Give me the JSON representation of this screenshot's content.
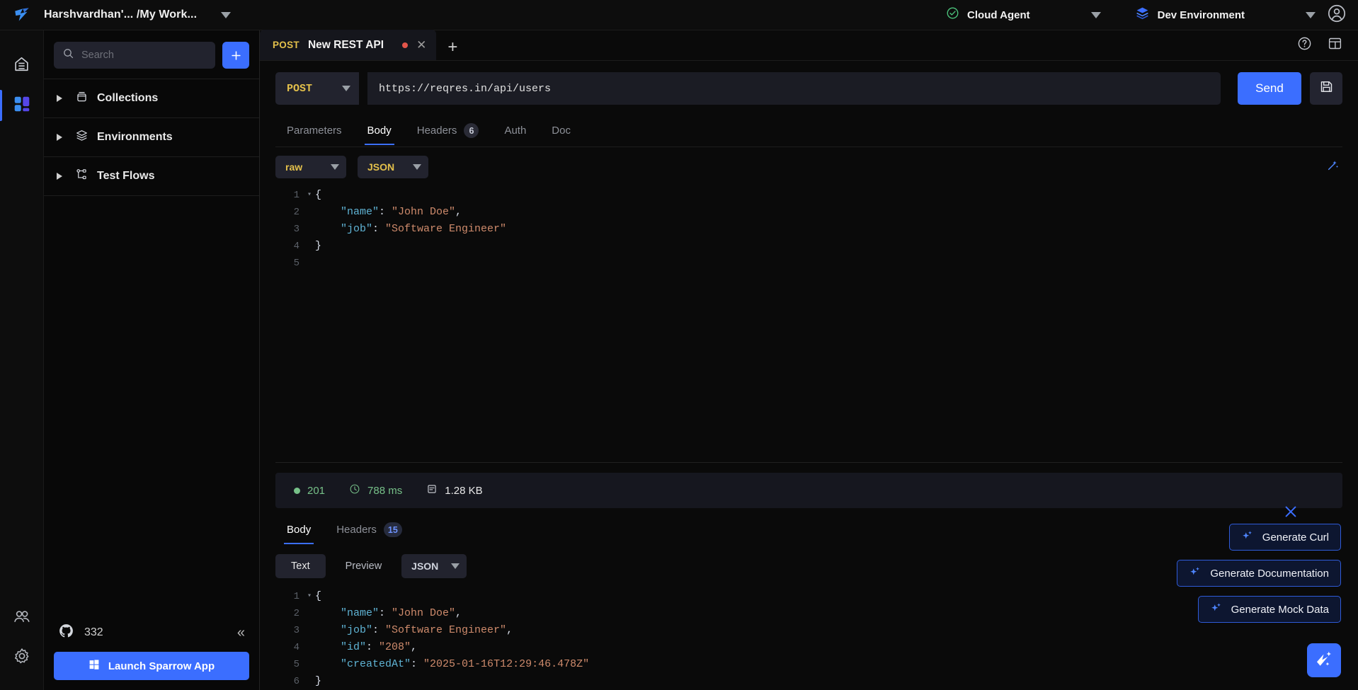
{
  "topbar": {
    "logo_icon": "sparrow-bird-logo",
    "workspace": "Harshvardhan'... /My Work...",
    "workspace_caret_icon": "chevron-down-icon",
    "cloud_agent": {
      "icon": "check-circle-icon",
      "label": "Cloud Agent",
      "caret_icon": "chevron-down-icon"
    },
    "environment": {
      "icon": "layers-icon",
      "label": "Dev Environment",
      "caret_icon": "chevron-down-icon"
    },
    "account_icon": "user-circle-icon"
  },
  "rail": {
    "items": [
      {
        "name": "home",
        "icon": "home-icon",
        "active": false
      },
      {
        "name": "workspaces",
        "icon": "grid-blocks-icon",
        "active": true
      }
    ],
    "bottom_items": [
      {
        "name": "team",
        "icon": "people-icon"
      },
      {
        "name": "settings",
        "icon": "gear-icon"
      }
    ]
  },
  "sidebar": {
    "search": {
      "icon": "search-icon",
      "placeholder": "Search",
      "value": ""
    },
    "add_button": {
      "icon": "plus-icon",
      "label": "+"
    },
    "items": [
      {
        "label": "Collections",
        "icon": "collection-icon",
        "expand_icon": "triangle-right-icon"
      },
      {
        "label": "Environments",
        "icon": "layers-icon",
        "expand_icon": "triangle-right-icon"
      },
      {
        "label": "Test Flows",
        "icon": "flow-nodes-icon",
        "expand_icon": "triangle-right-icon"
      }
    ],
    "github": {
      "icon": "github-icon",
      "count": "332"
    },
    "collapse_icon": "chevron-double-left-icon",
    "launch_button": {
      "icon": "windows-icon",
      "label": "Launch Sparrow App"
    }
  },
  "tabstrip": {
    "tabs": [
      {
        "method": "POST",
        "name": "New REST API",
        "dirty": true,
        "close_icon": "close-icon"
      }
    ],
    "new_tab_icon": "plus-icon",
    "help_icon": "question-circle-icon",
    "layout_icon": "layout-panels-icon"
  },
  "request": {
    "method": "POST",
    "method_caret_icon": "chevron-down-icon",
    "url": "https://reqres.in/api/users",
    "send_label": "Send",
    "save_icon": "floppy-disk-icon",
    "tabs": [
      {
        "label": "Parameters",
        "badge": null,
        "active": false
      },
      {
        "label": "Body",
        "badge": null,
        "active": true
      },
      {
        "label": "Headers",
        "badge": "6",
        "active": false
      },
      {
        "label": "Auth",
        "badge": null,
        "active": false
      },
      {
        "label": "Doc",
        "badge": null,
        "active": false
      }
    ],
    "body_type": "raw",
    "body_format": "JSON",
    "format_icon": "magic-wand-icon",
    "body_lines": [
      {
        "n": "1",
        "fold": true,
        "tokens": [
          {
            "t": "p",
            "v": "{"
          }
        ]
      },
      {
        "n": "2",
        "fold": false,
        "tokens": [
          {
            "t": "k",
            "v": "    \"name\""
          },
          {
            "t": "p",
            "v": ": "
          },
          {
            "t": "s",
            "v": "\"John Doe\""
          },
          {
            "t": "p",
            "v": ","
          }
        ]
      },
      {
        "n": "3",
        "fold": false,
        "tokens": [
          {
            "t": "k",
            "v": "    \"job\""
          },
          {
            "t": "p",
            "v": ": "
          },
          {
            "t": "s",
            "v": "\"Software Engineer\""
          }
        ]
      },
      {
        "n": "4",
        "fold": false,
        "tokens": [
          {
            "t": "p",
            "v": "}"
          }
        ]
      },
      {
        "n": "5",
        "fold": false,
        "tokens": []
      }
    ]
  },
  "response": {
    "status": {
      "code": "201",
      "time": "788 ms",
      "size": "1.28 KB",
      "status_dot_icon": "status-dot-icon",
      "clock_icon": "clock-icon",
      "size_icon": "database-icon"
    },
    "tabs": [
      {
        "label": "Body",
        "badge": null,
        "active": true
      },
      {
        "label": "Headers",
        "badge": "15",
        "active": false
      }
    ],
    "view_modes": [
      {
        "label": "Text",
        "active": true
      },
      {
        "label": "Preview",
        "active": false
      }
    ],
    "format": "JSON",
    "format_caret_icon": "chevron-down-icon",
    "body_lines": [
      {
        "n": "1",
        "fold": true,
        "tokens": [
          {
            "t": "p",
            "v": "{"
          }
        ]
      },
      {
        "n": "2",
        "fold": false,
        "tokens": [
          {
            "t": "k",
            "v": "    \"name\""
          },
          {
            "t": "p",
            "v": ": "
          },
          {
            "t": "s",
            "v": "\"John Doe\""
          },
          {
            "t": "p",
            "v": ","
          }
        ]
      },
      {
        "n": "3",
        "fold": false,
        "tokens": [
          {
            "t": "k",
            "v": "    \"job\""
          },
          {
            "t": "p",
            "v": ": "
          },
          {
            "t": "s",
            "v": "\"Software Engineer\""
          },
          {
            "t": "p",
            "v": ","
          }
        ]
      },
      {
        "n": "4",
        "fold": false,
        "tokens": [
          {
            "t": "k",
            "v": "    \"id\""
          },
          {
            "t": "p",
            "v": ": "
          },
          {
            "t": "s",
            "v": "\"208\""
          },
          {
            "t": "p",
            "v": ","
          }
        ]
      },
      {
        "n": "5",
        "fold": false,
        "tokens": [
          {
            "t": "k",
            "v": "    \"createdAt\""
          },
          {
            "t": "p",
            "v": ": "
          },
          {
            "t": "s",
            "v": "\"2025-01-16T12:29:46.478Z\""
          }
        ]
      },
      {
        "n": "6",
        "fold": false,
        "tokens": [
          {
            "t": "p",
            "v": "}"
          }
        ]
      }
    ]
  },
  "ai_panel": {
    "close_icon": "close-icon",
    "buttons": [
      {
        "label": "Generate Curl",
        "icon": "sparkle-icon"
      },
      {
        "label": "Generate Documentation",
        "icon": "sparkle-icon"
      },
      {
        "label": "Generate Mock Data",
        "icon": "sparkle-icon"
      }
    ],
    "fab_icon": "sparrow-ai-icon"
  },
  "colors": {
    "accent": "#3b6eff",
    "method": "#e3c04b",
    "success": "#77c189",
    "dirty": "#e2554a",
    "string": "#cf8b6c",
    "key": "#5fb3d4"
  }
}
